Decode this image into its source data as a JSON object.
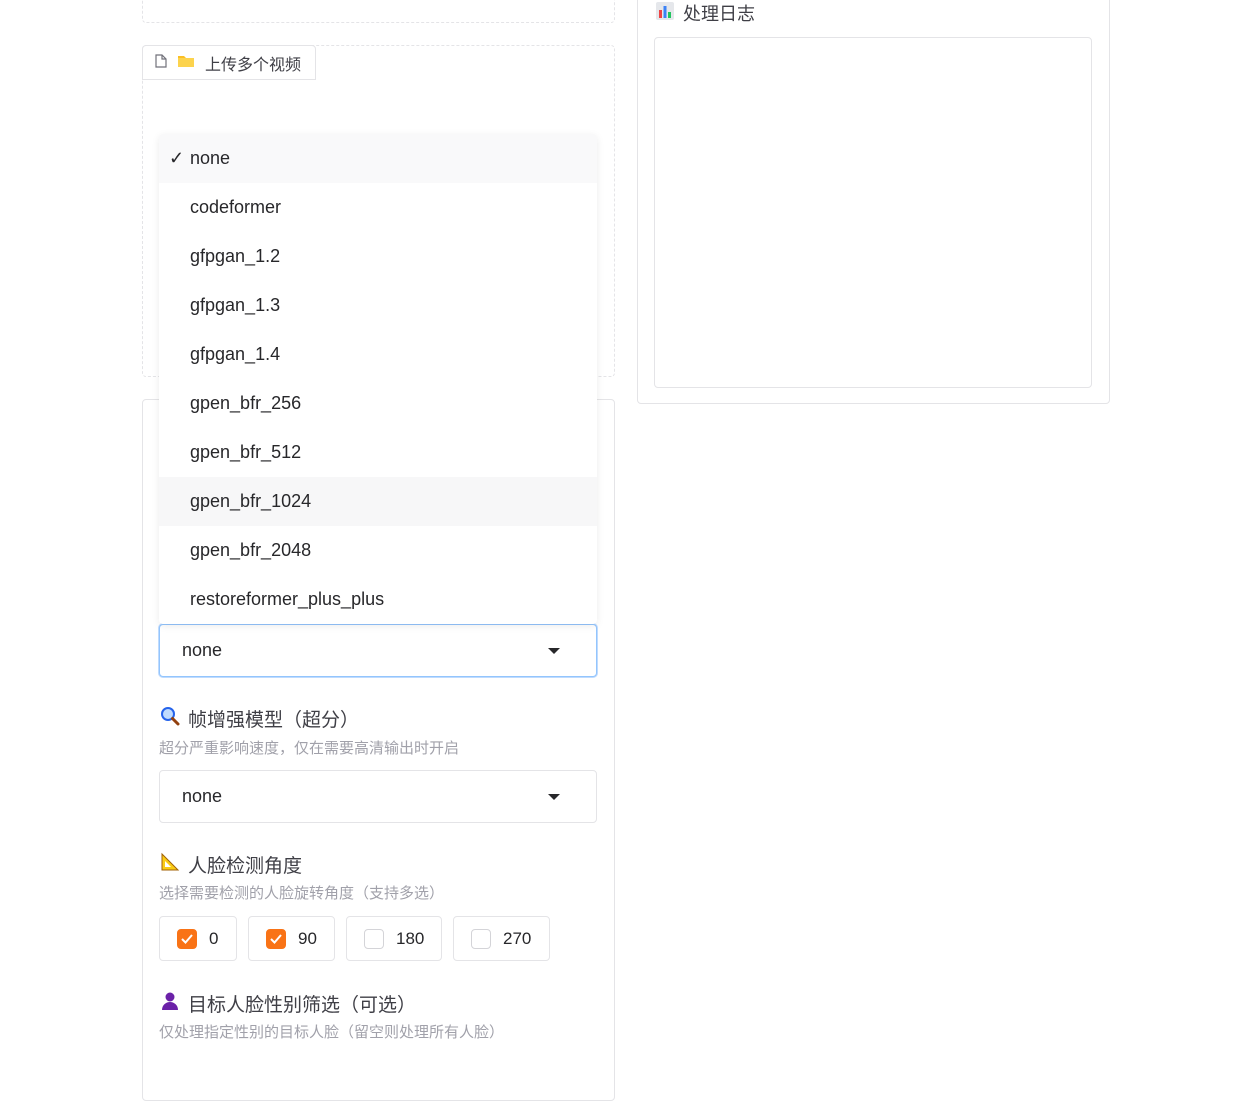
{
  "upload_tab": {
    "label": "上传多个视频"
  },
  "log": {
    "title": "处理日志",
    "content": ""
  },
  "face_enhancer": {
    "options": [
      "none",
      "codeformer",
      "gfpgan_1.2",
      "gfpgan_1.3",
      "gfpgan_1.4",
      "gpen_bfr_256",
      "gpen_bfr_512",
      "gpen_bfr_1024",
      "gpen_bfr_2048",
      "restoreformer_plus_plus"
    ],
    "selected": "none",
    "hovered": "gpen_bfr_1024",
    "check_mark": "✓"
  },
  "frame_enhancer": {
    "title": "帧增强模型（超分）",
    "description": "超分严重影响速度，仅在需要高清输出时开启",
    "value": "none"
  },
  "face_angle": {
    "title": "人脸检测角度",
    "description": "选择需要检测的人脸旋转角度（支持多选）",
    "choices": [
      {
        "label": "0",
        "checked": true
      },
      {
        "label": "90",
        "checked": true
      },
      {
        "label": "180",
        "checked": false
      },
      {
        "label": "270",
        "checked": false
      }
    ]
  },
  "gender_filter": {
    "title": "目标人脸性别筛选（可选）",
    "description": "仅处理指定性别的目标人脸（留空则处理所有人脸）"
  },
  "colors": {
    "accent": "#f97316",
    "focus": "#93c5fd"
  }
}
